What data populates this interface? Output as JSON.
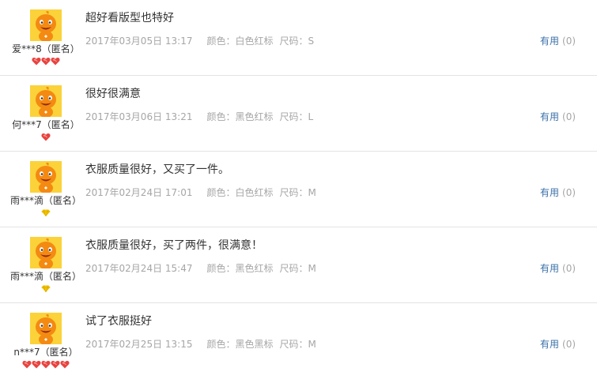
{
  "reviews": [
    {
      "content": "超好看版型也特好",
      "nickname": "爱***8（匿名）",
      "date": "2017年03月05日 13:17",
      "color": "颜色：白色红标",
      "size": "尺码：S",
      "useful_label": "有用",
      "useful_count": "(0)",
      "badge": "heart",
      "badge_count": 3
    },
    {
      "content": "很好很满意",
      "nickname": "何***7（匿名）",
      "date": "2017年03月06日 13:21",
      "color": "颜色：黑色红标",
      "size": "尺码：L",
      "useful_label": "有用",
      "useful_count": "(0)",
      "badge": "heart",
      "badge_count": 1
    },
    {
      "content": "衣服质量很好，又买了一件。",
      "nickname": "雨***滴（匿名）",
      "date": "2017年02月24日 17:01",
      "color": "颜色：白色红标",
      "size": "尺码：M",
      "useful_label": "有用",
      "useful_count": "(0)",
      "badge": "diamond",
      "badge_count": 1
    },
    {
      "content": "衣服质量很好，买了两件，很满意！",
      "nickname": "雨***滴（匿名）",
      "date": "2017年02月24日 15:47",
      "color": "颜色：黑色红标",
      "size": "尺码：M",
      "useful_label": "有用",
      "useful_count": "(0)",
      "badge": "diamond",
      "badge_count": 1
    },
    {
      "content": "试了衣服挺好",
      "nickname": "n***7（匿名）",
      "date": "2017年02月25日 13:15",
      "color": "颜色：黑色黑标",
      "size": "尺码：M",
      "useful_label": "有用",
      "useful_count": "(0)",
      "badge": "heart",
      "badge_count": 5
    }
  ],
  "colors": {
    "heart_badge": "#e8433f",
    "diamond_badge": "#f5c400",
    "link": "#3a6fa8",
    "meta_text": "#a6a6a6"
  }
}
